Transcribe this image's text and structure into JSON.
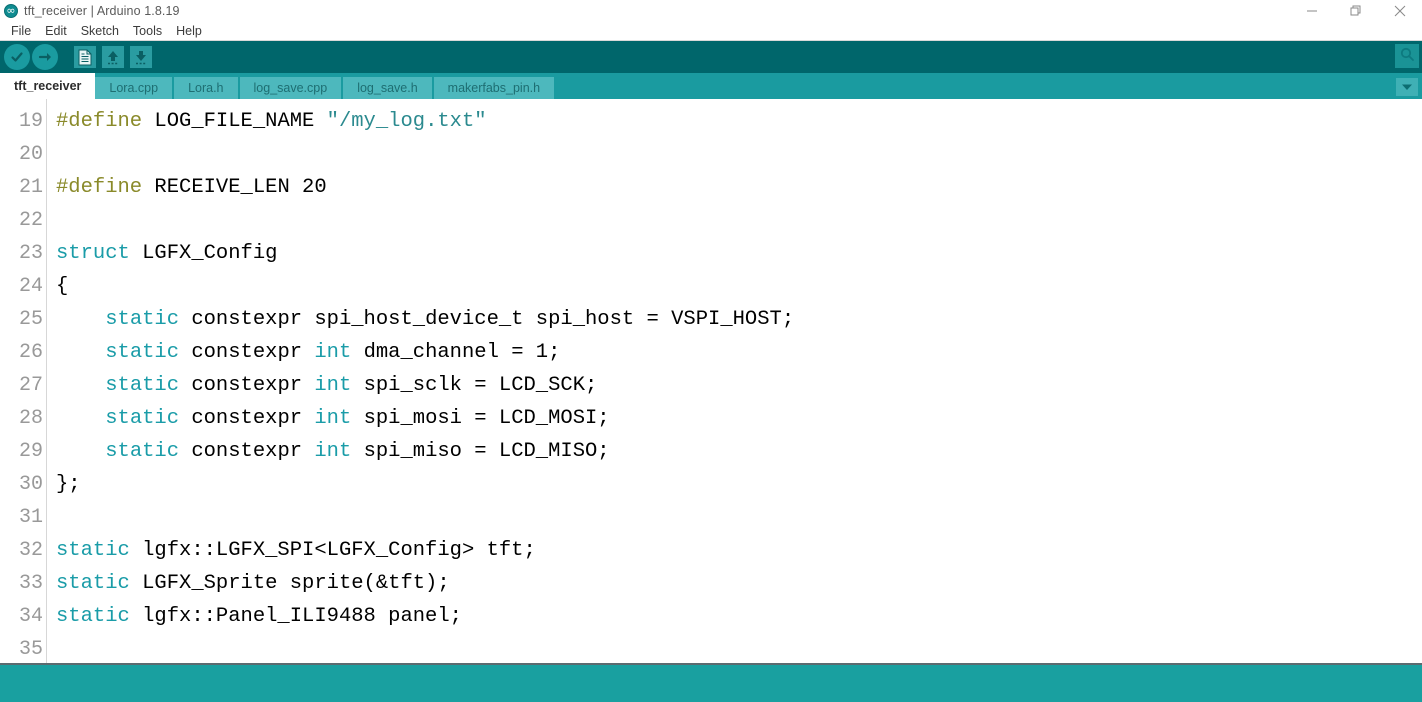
{
  "window": {
    "title": "tft_receiver | Arduino 1.8.19",
    "app_icon": "arduino-logo-icon",
    "controls": {
      "minimize": "minimize-icon",
      "restore": "restore-icon",
      "close": "close-icon"
    }
  },
  "menubar": {
    "items": [
      {
        "label": "File"
      },
      {
        "label": "Edit"
      },
      {
        "label": "Sketch"
      },
      {
        "label": "Tools"
      },
      {
        "label": "Help"
      }
    ]
  },
  "toolbar": {
    "buttons": [
      {
        "name": "verify-button",
        "icon": "checkmark-circle-icon",
        "tooltip": "Verify"
      },
      {
        "name": "upload-button",
        "icon": "arrow-right-circle-icon",
        "tooltip": "Upload"
      },
      {
        "name": "new-button",
        "icon": "new-document-icon",
        "tooltip": "New"
      },
      {
        "name": "open-button",
        "icon": "arrow-up-icon",
        "tooltip": "Open"
      },
      {
        "name": "save-button",
        "icon": "arrow-down-icon",
        "tooltip": "Save"
      }
    ],
    "serial_monitor": {
      "name": "serial-monitor-button",
      "icon": "magnifier-icon",
      "tooltip": "Serial Monitor"
    },
    "background_color": "#00666b"
  },
  "tabs": {
    "items": [
      {
        "label": "tft_receiver",
        "active": true
      },
      {
        "label": "Lora.cpp",
        "active": false
      },
      {
        "label": "Lora.h",
        "active": false
      },
      {
        "label": "log_save.cpp",
        "active": false
      },
      {
        "label": "log_save.h",
        "active": false
      },
      {
        "label": "makerfabs_pin.h",
        "active": false
      }
    ],
    "dropdown_icon": "chevron-down-icon",
    "bar_color": "#1a9ba0",
    "inactive_tab_color": "#4db8bd"
  },
  "editor": {
    "first_line": 19,
    "lines": [
      {
        "n": 19,
        "tokens": [
          {
            "t": "#define ",
            "c": "pre"
          },
          {
            "t": "LOG_FILE_NAME ",
            "c": "plain"
          },
          {
            "t": "\"/my_log.txt\"",
            "c": "str"
          }
        ]
      },
      {
        "n": 20,
        "tokens": []
      },
      {
        "n": 21,
        "tokens": [
          {
            "t": "#define ",
            "c": "pre"
          },
          {
            "t": "RECEIVE_LEN 20",
            "c": "plain"
          }
        ]
      },
      {
        "n": 22,
        "tokens": []
      },
      {
        "n": 23,
        "tokens": [
          {
            "t": "struct",
            "c": "kw"
          },
          {
            "t": " LGFX_Config",
            "c": "plain"
          }
        ]
      },
      {
        "n": 24,
        "tokens": [
          {
            "t": "{",
            "c": "plain"
          }
        ]
      },
      {
        "n": 25,
        "tokens": [
          {
            "t": "    ",
            "c": "plain"
          },
          {
            "t": "static",
            "c": "kw"
          },
          {
            "t": " constexpr spi_host_device_t spi_host = VSPI_HOST;",
            "c": "plain"
          }
        ]
      },
      {
        "n": 26,
        "tokens": [
          {
            "t": "    ",
            "c": "plain"
          },
          {
            "t": "static",
            "c": "kw"
          },
          {
            "t": " constexpr ",
            "c": "plain"
          },
          {
            "t": "int",
            "c": "kw"
          },
          {
            "t": " dma_channel = 1;",
            "c": "plain"
          }
        ]
      },
      {
        "n": 27,
        "tokens": [
          {
            "t": "    ",
            "c": "plain"
          },
          {
            "t": "static",
            "c": "kw"
          },
          {
            "t": " constexpr ",
            "c": "plain"
          },
          {
            "t": "int",
            "c": "kw"
          },
          {
            "t": " spi_sclk = LCD_SCK;",
            "c": "plain"
          }
        ]
      },
      {
        "n": 28,
        "tokens": [
          {
            "t": "    ",
            "c": "plain"
          },
          {
            "t": "static",
            "c": "kw"
          },
          {
            "t": " constexpr ",
            "c": "plain"
          },
          {
            "t": "int",
            "c": "kw"
          },
          {
            "t": " spi_mosi = LCD_MOSI;",
            "c": "plain"
          }
        ]
      },
      {
        "n": 29,
        "tokens": [
          {
            "t": "    ",
            "c": "plain"
          },
          {
            "t": "static",
            "c": "kw"
          },
          {
            "t": " constexpr ",
            "c": "plain"
          },
          {
            "t": "int",
            "c": "kw"
          },
          {
            "t": " spi_miso = LCD_MISO;",
            "c": "plain"
          }
        ]
      },
      {
        "n": 30,
        "tokens": [
          {
            "t": "};",
            "c": "plain"
          }
        ]
      },
      {
        "n": 31,
        "tokens": []
      },
      {
        "n": 32,
        "tokens": [
          {
            "t": "static",
            "c": "kw"
          },
          {
            "t": " lgfx::LGFX_SPI<LGFX_Config> tft;",
            "c": "plain"
          }
        ]
      },
      {
        "n": 33,
        "tokens": [
          {
            "t": "static",
            "c": "kw"
          },
          {
            "t": " LGFX_Sprite sprite(&tft);",
            "c": "plain"
          }
        ]
      },
      {
        "n": 34,
        "tokens": [
          {
            "t": "static",
            "c": "kw"
          },
          {
            "t": " lgfx::Panel_ILI9488 panel;",
            "c": "plain"
          }
        ]
      },
      {
        "n": 35,
        "tokens": []
      }
    ],
    "colors": {
      "keyword": "#1a9ca8",
      "preprocessor": "#8a8a2a",
      "string": "#2b8a8f",
      "plain": "#000000",
      "line_number": "#999999"
    }
  },
  "statusbar": {
    "message": "",
    "background_color": "#19a0a0"
  }
}
